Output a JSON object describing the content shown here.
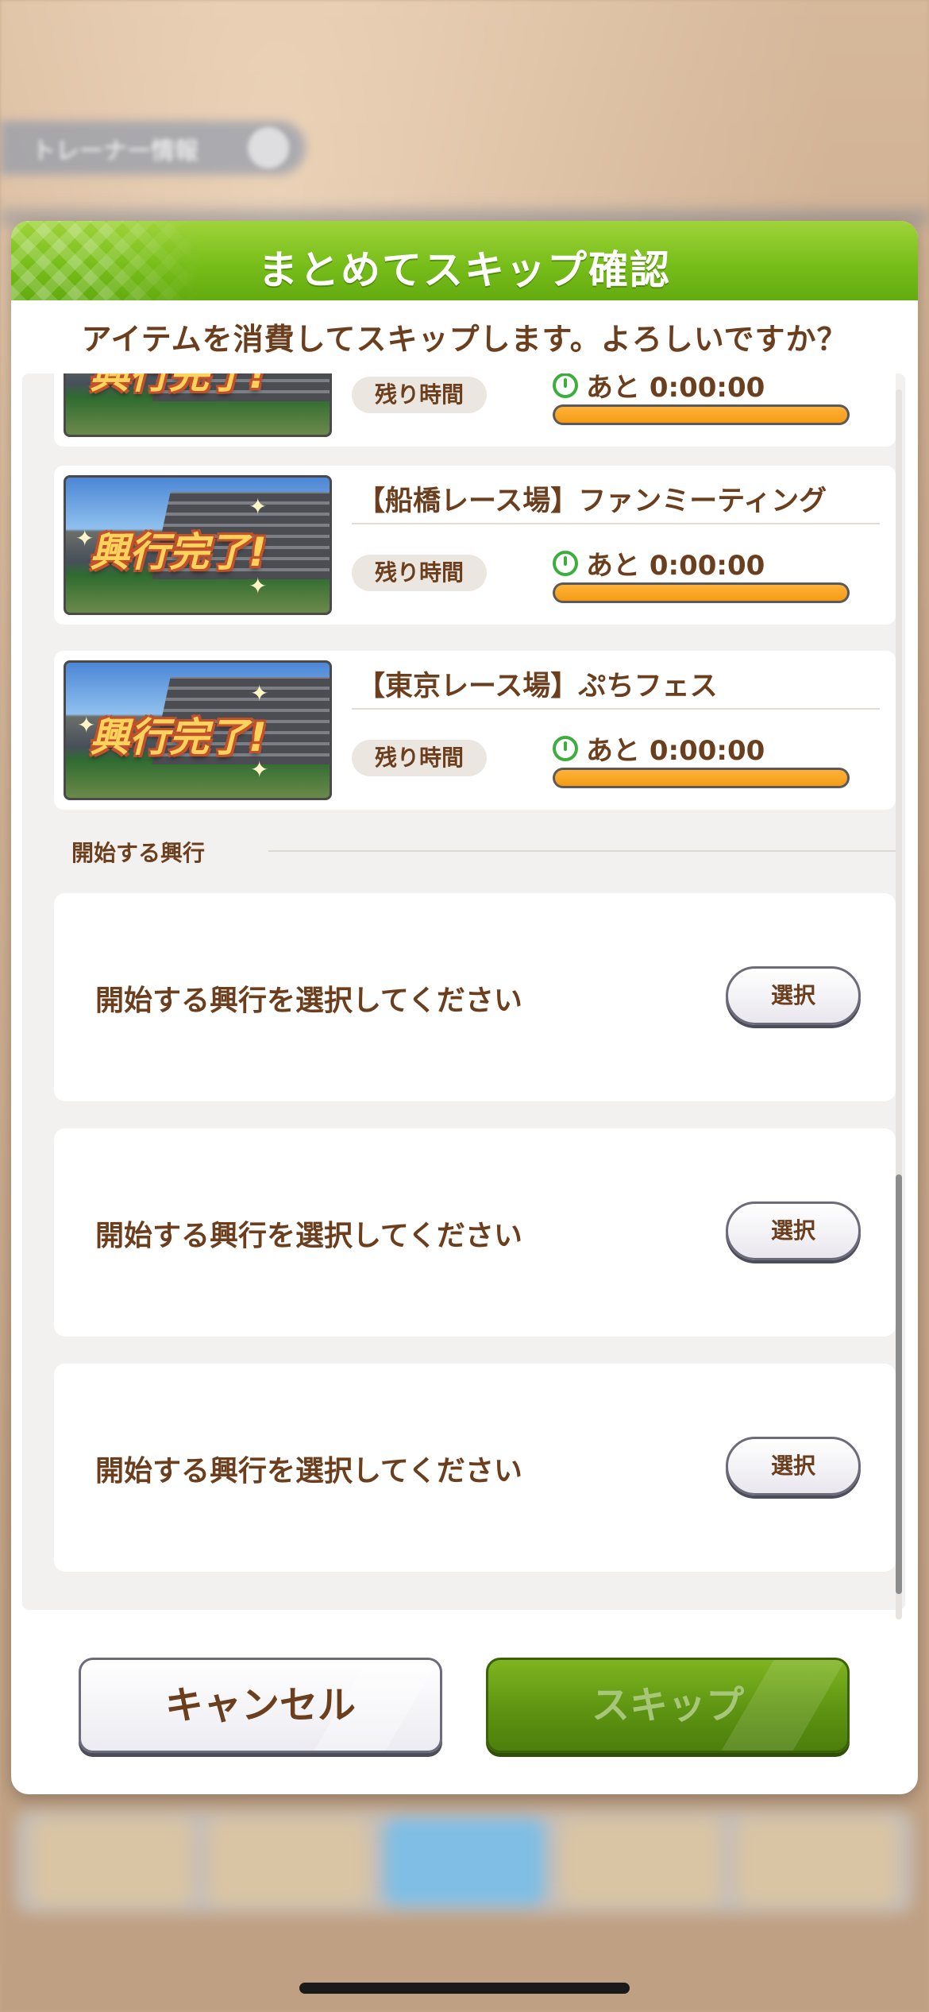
{
  "background": {
    "header_label": "トレーナー情報"
  },
  "modal": {
    "title": "まとめてスキップ確認",
    "subtitle": "アイテムを消費してスキップします。よろしいですか？"
  },
  "running_events": [
    {
      "name": "",
      "thumb_label": "興行完了!",
      "remaining_label": "残り時間",
      "time_text": "あと 0:00:00",
      "progress": 1.0
    },
    {
      "name": "【船橋レース場】ファンミーティング",
      "thumb_label": "興行完了!",
      "remaining_label": "残り時間",
      "time_text": "あと 0:00:00",
      "progress": 1.0
    },
    {
      "name": "【東京レース場】ぷちフェス",
      "thumb_label": "興行完了!",
      "remaining_label": "残り時間",
      "time_text": "あと 0:00:00",
      "progress": 1.0
    }
  ],
  "start_section": {
    "header": "開始する興行",
    "slots": [
      {
        "prompt": "開始する興行を選択してください",
        "button_label": "選択"
      },
      {
        "prompt": "開始する興行を選択してください",
        "button_label": "選択"
      },
      {
        "prompt": "開始する興行を選択してください",
        "button_label": "選択"
      }
    ]
  },
  "footer": {
    "cancel_label": "キャンセル",
    "skip_label": "スキップ"
  },
  "colors": {
    "title_bar": "#78be1a",
    "text_brown": "#6b3f1e",
    "progress_orange": "#f59b14",
    "clock_green": "#3dae3d",
    "skip_green": "#5e9412"
  },
  "icons": {
    "clock": "clock-icon",
    "info": "info-icon"
  }
}
